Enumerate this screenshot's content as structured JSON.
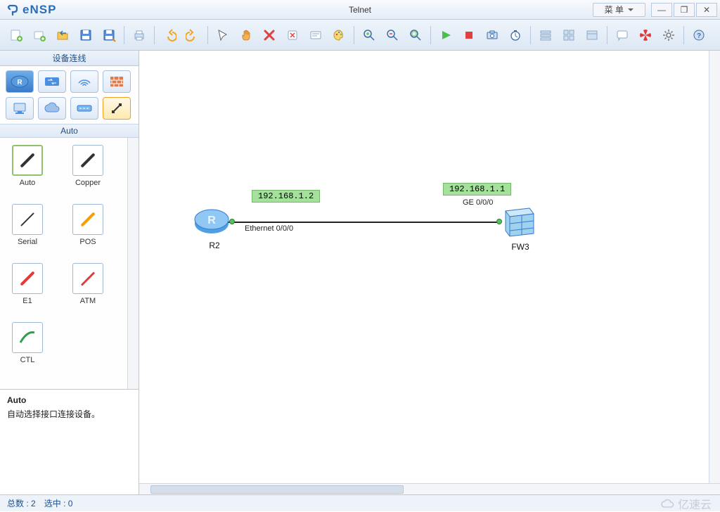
{
  "app": {
    "name": "eNSP",
    "title": "Telnet",
    "menu_label": "菜 单"
  },
  "window_controls": {
    "min": "—",
    "max": "❐",
    "close": "✕"
  },
  "sidebar": {
    "title": "设备连线",
    "subtitle": "Auto",
    "categories": [
      {
        "id": "router",
        "icon": "R"
      },
      {
        "id": "switch",
        "icon": "⇄"
      },
      {
        "id": "wlan",
        "icon": "📶"
      },
      {
        "id": "firewall",
        "icon": "▦"
      },
      {
        "id": "pc",
        "icon": "🖥"
      },
      {
        "id": "cloud",
        "icon": "☁"
      },
      {
        "id": "hub",
        "icon": "≡"
      },
      {
        "id": "link",
        "icon": "⚡",
        "selected": true
      }
    ],
    "devices": [
      {
        "id": "auto",
        "label": "Auto",
        "color": "#333",
        "selected": true
      },
      {
        "id": "copper",
        "label": "Copper",
        "color": "#333"
      },
      {
        "id": "serial",
        "label": "Serial",
        "color": "#333"
      },
      {
        "id": "pos",
        "label": "POS",
        "color": "#f59e0b"
      },
      {
        "id": "e1",
        "label": "E1",
        "color": "#e03a3a"
      },
      {
        "id": "atm",
        "label": "ATM",
        "color": "#e03a3a"
      },
      {
        "id": "ctl",
        "label": "CTL",
        "color": "#2e9e4a"
      }
    ],
    "description": {
      "title": "Auto",
      "text": "自动选择接口连接设备。"
    }
  },
  "topology": {
    "r2": {
      "label": "R2",
      "ip": "192.168.1.2",
      "iface": "Ethernet 0/0/0"
    },
    "fw3": {
      "label": "FW3",
      "ip": "192.168.1.1",
      "iface": "GE 0/0/0"
    }
  },
  "status": {
    "total_label": "总数",
    "total": "2",
    "sel_label": "选中",
    "sel": "0"
  },
  "watermark": "亿速云"
}
